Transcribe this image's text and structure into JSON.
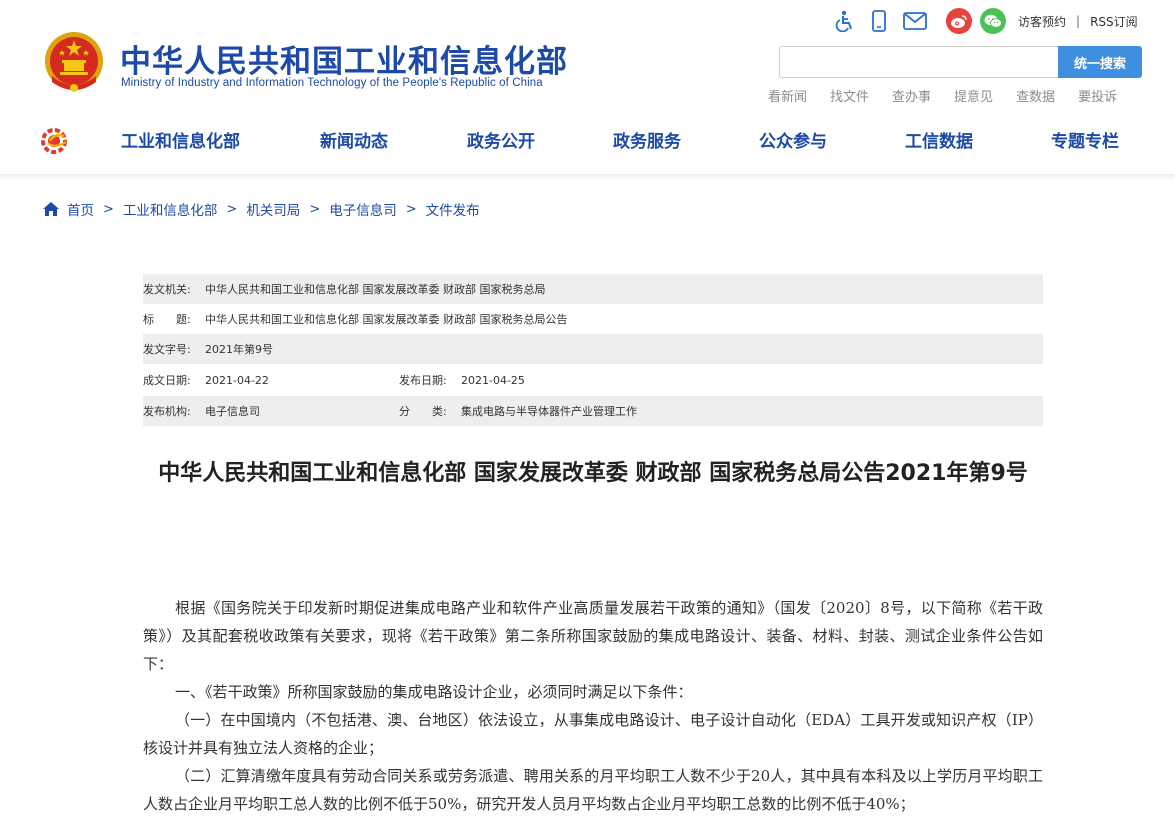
{
  "header": {
    "title": "中华人民共和国工业和信息化部",
    "subtitle": "Ministry of Industry and Information Technology of the People's Republic of China",
    "visit_label": "访客预约",
    "separator": "|",
    "rss_label": "RSS订阅",
    "icons": [
      "accessibility-icon",
      "mobile-icon",
      "mail-icon",
      "weibo-icon",
      "wechat-icon"
    ],
    "search": {
      "placeholder": "",
      "button_label": "统一搜索"
    },
    "quick_links": [
      "看新闻",
      "找文件",
      "查办事",
      "提意见",
      "查数据",
      "要投诉"
    ]
  },
  "nav": {
    "items": [
      "工业和信息化部",
      "新闻动态",
      "政务公开",
      "政务服务",
      "公众参与",
      "工信数据",
      "专题专栏"
    ]
  },
  "breadcrumb": {
    "items": [
      "首页",
      "工业和信息化部",
      "机关司局",
      "电子信息司",
      "文件发布"
    ],
    "separator": ">"
  },
  "info": {
    "issuer_label": "发文机关:",
    "issuer": "中华人民共和国工业和信息化部 国家发展改革委 财政部 国家税务总局",
    "title_label": "标　　题:",
    "title": "中华人民共和国工业和信息化部 国家发展改革委 财政部 国家税务总局公告",
    "doc_no_label": "发文字号:",
    "doc_no": "2021年第9号",
    "written_label": "成文日期:",
    "written_date": "2021-04-22",
    "published_label": "发布日期:",
    "published_date": "2021-04-25",
    "org_label": "发布机构:",
    "org": "电子信息司",
    "category_label": "分　　类:",
    "category": "集成电路与半导体器件产业管理工作"
  },
  "article": {
    "title": "中华人民共和国工业和信息化部 国家发展改革委 财政部 国家税务总局公告2021年第9号",
    "paragraphs": [
      "根据《国务院关于印发新时期促进集成电路产业和软件产业高质量发展若干政策的通知》（国发〔2020〕8号，以下简称《若干政策》）及其配套税收政策有关要求，现将《若干政策》第二条所称国家鼓励的集成电路设计、装备、材料、封装、测试企业条件公告如下：",
      "一、《若干政策》所称国家鼓励的集成电路设计企业，必须同时满足以下条件：",
      "（一）在中国境内（不包括港、澳、台地区）依法设立，从事集成电路设计、电子设计自动化（EDA）工具开发或知识产权（IP）核设计并具有独立法人资格的企业；",
      "（二）汇算清缴年度具有劳动合同关系或劳务派遣、聘用关系的月平均职工人数不少于20人，其中具有本科及以上学历月平均职工人数占企业月平均职工总人数的比例不低于50%，研究开发人员月平均数占企业月平均职工总数的比例不低于40%；"
    ]
  }
}
